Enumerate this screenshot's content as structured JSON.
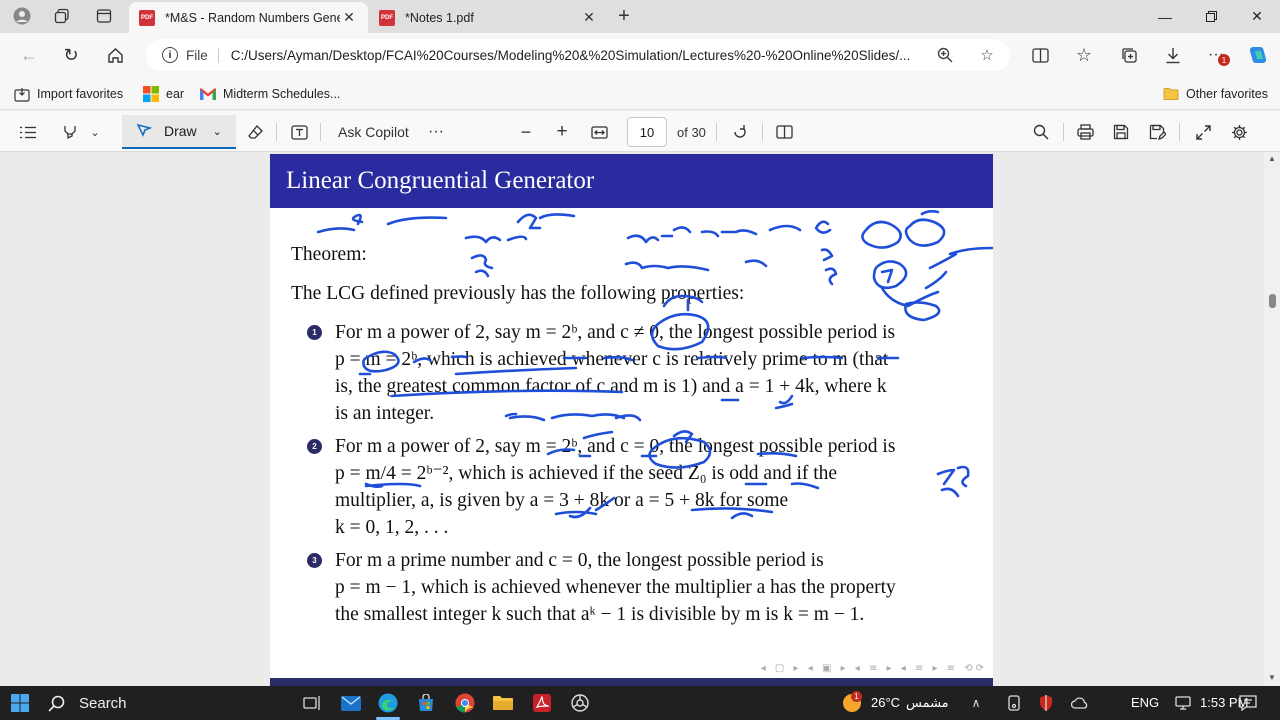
{
  "browser": {
    "tabs": [
      {
        "label": "*M&S - Random Numbers Gene",
        "active": true,
        "icon": "pdf-icon"
      },
      {
        "label": "*Notes 1.pdf",
        "active": false,
        "icon": "pdf-icon"
      }
    ],
    "omnibox": {
      "scheme_label": "File",
      "url": "C:/Users/Ayman/Desktop/FCAI%20Courses/Modeling%20&%20Simulation/Lectures%20-%20Online%20Slides/..."
    },
    "favorites": [
      {
        "label": "Import favorites"
      },
      {
        "label": "ear"
      },
      {
        "label": "Midterm Schedules..."
      }
    ],
    "other_favorites": "Other favorites",
    "notification_count": "1"
  },
  "pdf_toolbar": {
    "draw_label": "Draw",
    "ask_copilot_label": "Ask Copilot",
    "page_current": "10",
    "page_total": "of 30"
  },
  "slide": {
    "title": "Linear Congruential Generator",
    "theorem_label": "Theorem:",
    "intro": "The LCG defined previously has the following properties:",
    "items": [
      {
        "marker": "1",
        "lines": [
          "For m a power of 2, say m = 2ᵇ, and c ≠ 0, the longest possible period is",
          "p = m = 2ᵇ, which is achieved whenever c is relatively prime to m (that",
          "is, the greatest common factor of c and m is 1) and a = 1 + 4k, where k",
          "is an integer."
        ]
      },
      {
        "marker": "2",
        "lines": [
          "For m a power of 2, say m = 2ᵇ, and c = 0, the longest possible period is",
          "p = m/4 = 2ᵇ⁻², which is achieved if the seed Z₀ is odd and if the",
          "multiplier, a, is given by a = 3 + 8k or a = 5 + 8k for some",
          "k = 0, 1, 2, . . ."
        ]
      },
      {
        "marker": "3",
        "lines": [
          "For m a prime number and c = 0, the longest possible period is",
          "p = m − 1, which is achieved whenever the multiplier a has the property",
          "the smallest integer k such that aᵏ − 1 is divisible by m is k = m − 1."
        ]
      }
    ]
  },
  "taskbar": {
    "search_label": "Search",
    "weather": "26°C",
    "weather_badge": "1",
    "weather_text": "مشمس",
    "language": "ENG",
    "time": "1:53 PM"
  },
  "colors": {
    "slide_header": "#2b2ba0",
    "ink": "#1f4fd8",
    "accent": "#0f6cbd"
  }
}
